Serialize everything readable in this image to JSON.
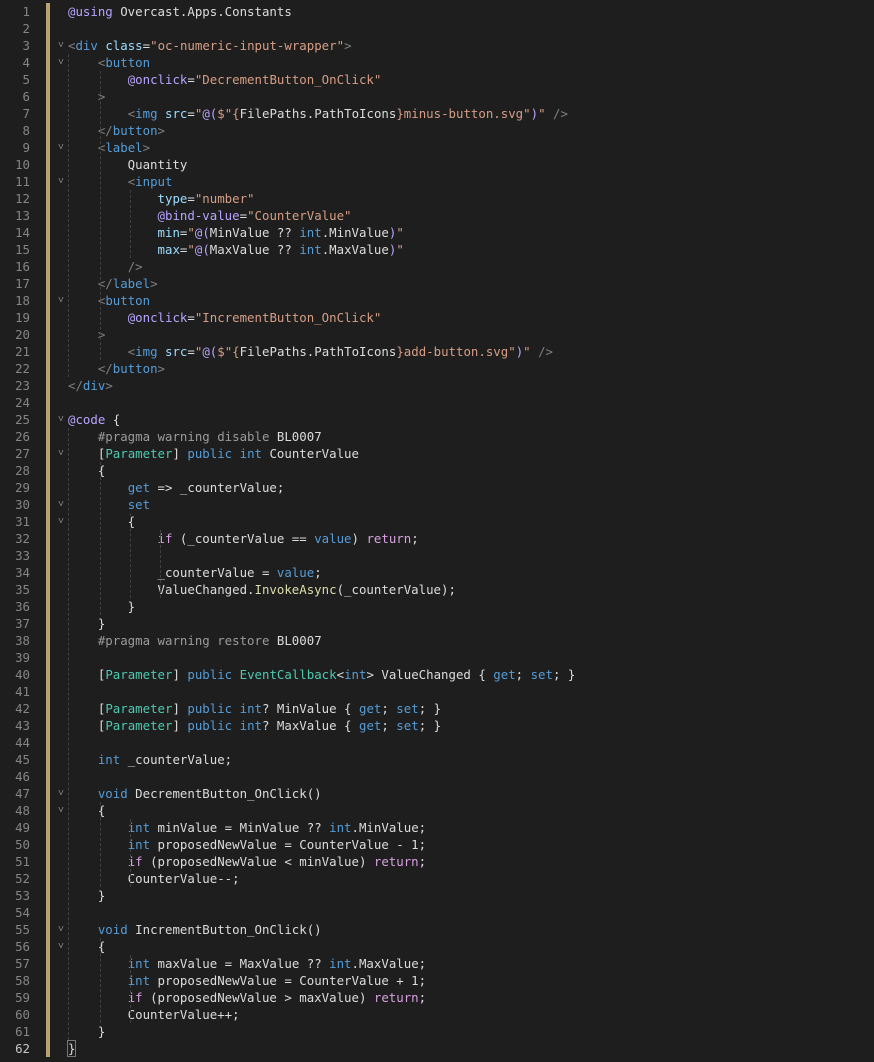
{
  "editor": {
    "current_line": 62,
    "lines": [
      [
        [
          "@using",
          "k-razor"
        ],
        [
          " Overcast.Apps.Constants",
          "k-plain"
        ]
      ],
      [],
      [
        [
          "<",
          "k-punc"
        ],
        [
          "div",
          "k-tag"
        ],
        [
          " ",
          "k-plain"
        ],
        [
          "class",
          "k-attr"
        ],
        [
          "=",
          "k-plain"
        ],
        [
          "\"oc-numeric-input-wrapper\"",
          "k-str"
        ],
        [
          ">",
          "k-punc"
        ]
      ],
      [
        [
          "    ",
          "k-plain"
        ],
        [
          "<",
          "k-punc"
        ],
        [
          "button",
          "k-tag"
        ]
      ],
      [
        [
          "        ",
          "k-plain"
        ],
        [
          "@onclick",
          "k-razor"
        ],
        [
          "=",
          "k-plain"
        ],
        [
          "\"DecrementButton_OnClick\"",
          "k-str"
        ]
      ],
      [
        [
          "    ",
          "k-plain"
        ],
        [
          ">",
          "k-punc"
        ]
      ],
      [
        [
          "        ",
          "k-plain"
        ],
        [
          "<",
          "k-punc"
        ],
        [
          "img",
          "k-tag"
        ],
        [
          " ",
          "k-plain"
        ],
        [
          "src",
          "k-attr"
        ],
        [
          "=",
          "k-plain"
        ],
        [
          "\"",
          "k-str"
        ],
        [
          "@(",
          "k-razor"
        ],
        [
          "$\"{",
          "k-str"
        ],
        [
          "FilePaths",
          "k-plain"
        ],
        [
          ".",
          "k-plain"
        ],
        [
          "PathToIcons",
          "k-plain"
        ],
        [
          "}minus-button.svg\"",
          "k-str"
        ],
        [
          ")",
          "k-razor"
        ],
        [
          "\"",
          "k-str"
        ],
        [
          " />",
          "k-punc"
        ]
      ],
      [
        [
          "    ",
          "k-plain"
        ],
        [
          "</",
          "k-punc"
        ],
        [
          "button",
          "k-tag"
        ],
        [
          ">",
          "k-punc"
        ]
      ],
      [
        [
          "    ",
          "k-plain"
        ],
        [
          "<",
          "k-punc"
        ],
        [
          "label",
          "k-tag"
        ],
        [
          ">",
          "k-punc"
        ]
      ],
      [
        [
          "        Quantity",
          "k-text"
        ]
      ],
      [
        [
          "        ",
          "k-plain"
        ],
        [
          "<",
          "k-punc"
        ],
        [
          "input",
          "k-tag"
        ]
      ],
      [
        [
          "            ",
          "k-plain"
        ],
        [
          "type",
          "k-attr"
        ],
        [
          "=",
          "k-plain"
        ],
        [
          "\"number\"",
          "k-str"
        ]
      ],
      [
        [
          "            ",
          "k-plain"
        ],
        [
          "@bind-value",
          "k-razor"
        ],
        [
          "=",
          "k-plain"
        ],
        [
          "\"CounterValue\"",
          "k-str"
        ]
      ],
      [
        [
          "            ",
          "k-plain"
        ],
        [
          "min",
          "k-attr"
        ],
        [
          "=",
          "k-plain"
        ],
        [
          "\"",
          "k-str"
        ],
        [
          "@(",
          "k-razor"
        ],
        [
          "MinValue ?? ",
          "k-plain"
        ],
        [
          "int",
          "k-kw"
        ],
        [
          ".MinValue",
          "k-plain"
        ],
        [
          ")",
          "k-razor"
        ],
        [
          "\"",
          "k-str"
        ]
      ],
      [
        [
          "            ",
          "k-plain"
        ],
        [
          "max",
          "k-attr"
        ],
        [
          "=",
          "k-plain"
        ],
        [
          "\"",
          "k-str"
        ],
        [
          "@(",
          "k-razor"
        ],
        [
          "MaxValue ?? ",
          "k-plain"
        ],
        [
          "int",
          "k-kw"
        ],
        [
          ".MaxValue",
          "k-plain"
        ],
        [
          ")",
          "k-razor"
        ],
        [
          "\"",
          "k-str"
        ]
      ],
      [
        [
          "        ",
          "k-plain"
        ],
        [
          "/>",
          "k-punc"
        ]
      ],
      [
        [
          "    ",
          "k-plain"
        ],
        [
          "</",
          "k-punc"
        ],
        [
          "label",
          "k-tag"
        ],
        [
          ">",
          "k-punc"
        ]
      ],
      [
        [
          "    ",
          "k-plain"
        ],
        [
          "<",
          "k-punc"
        ],
        [
          "button",
          "k-tag"
        ]
      ],
      [
        [
          "        ",
          "k-plain"
        ],
        [
          "@onclick",
          "k-razor"
        ],
        [
          "=",
          "k-plain"
        ],
        [
          "\"IncrementButton_OnClick\"",
          "k-str"
        ]
      ],
      [
        [
          "    ",
          "k-plain"
        ],
        [
          ">",
          "k-punc"
        ]
      ],
      [
        [
          "        ",
          "k-plain"
        ],
        [
          "<",
          "k-punc"
        ],
        [
          "img",
          "k-tag"
        ],
        [
          " ",
          "k-plain"
        ],
        [
          "src",
          "k-attr"
        ],
        [
          "=",
          "k-plain"
        ],
        [
          "\"",
          "k-str"
        ],
        [
          "@(",
          "k-razor"
        ],
        [
          "$\"{",
          "k-str"
        ],
        [
          "FilePaths",
          "k-plain"
        ],
        [
          ".",
          "k-plain"
        ],
        [
          "PathToIcons",
          "k-plain"
        ],
        [
          "}add-button.svg\"",
          "k-str"
        ],
        [
          ")",
          "k-razor"
        ],
        [
          "\"",
          "k-str"
        ],
        [
          " />",
          "k-punc"
        ]
      ],
      [
        [
          "    ",
          "k-plain"
        ],
        [
          "</",
          "k-punc"
        ],
        [
          "button",
          "k-tag"
        ],
        [
          ">",
          "k-punc"
        ]
      ],
      [
        [
          "</",
          "k-punc"
        ],
        [
          "div",
          "k-tag"
        ],
        [
          ">",
          "k-punc"
        ]
      ],
      [],
      [
        [
          "@code",
          "k-razor"
        ],
        [
          " {",
          "k-plain"
        ]
      ],
      [
        [
          "    ",
          "k-plain"
        ],
        [
          "#pragma warning disable ",
          "k-pre"
        ],
        [
          "BL0007",
          "k-plain"
        ]
      ],
      [
        [
          "    ",
          "k-plain"
        ],
        [
          "[",
          "k-plain"
        ],
        [
          "Parameter",
          "k-type"
        ],
        [
          "] ",
          "k-plain"
        ],
        [
          "public",
          "k-kw"
        ],
        [
          " ",
          "k-plain"
        ],
        [
          "int",
          "k-kw"
        ],
        [
          " CounterValue",
          "k-plain"
        ]
      ],
      [
        [
          "    {",
          "k-plain"
        ]
      ],
      [
        [
          "        ",
          "k-plain"
        ],
        [
          "get",
          "k-kw"
        ],
        [
          " => _counterValue;",
          "k-plain"
        ]
      ],
      [
        [
          "        ",
          "k-plain"
        ],
        [
          "set",
          "k-kw"
        ]
      ],
      [
        [
          "        {",
          "k-plain"
        ]
      ],
      [
        [
          "            ",
          "k-plain"
        ],
        [
          "if",
          "k-ctl"
        ],
        [
          " (_counterValue == ",
          "k-plain"
        ],
        [
          "value",
          "k-kw"
        ],
        [
          ") ",
          "k-plain"
        ],
        [
          "return",
          "k-ctl"
        ],
        [
          ";",
          "k-plain"
        ]
      ],
      [],
      [
        [
          "            _counterValue = ",
          "k-plain"
        ],
        [
          "value",
          "k-kw"
        ],
        [
          ";",
          "k-plain"
        ]
      ],
      [
        [
          "            ValueChanged.",
          "k-plain"
        ],
        [
          "InvokeAsync",
          "k-method"
        ],
        [
          "(_counterValue);",
          "k-plain"
        ]
      ],
      [
        [
          "        }",
          "k-plain"
        ]
      ],
      [
        [
          "    }",
          "k-plain"
        ]
      ],
      [
        [
          "    ",
          "k-plain"
        ],
        [
          "#pragma warning restore ",
          "k-pre"
        ],
        [
          "BL0007",
          "k-plain"
        ]
      ],
      [],
      [
        [
          "    ",
          "k-plain"
        ],
        [
          "[",
          "k-plain"
        ],
        [
          "Parameter",
          "k-type"
        ],
        [
          "] ",
          "k-plain"
        ],
        [
          "public",
          "k-kw"
        ],
        [
          " ",
          "k-plain"
        ],
        [
          "EventCallback",
          "k-type"
        ],
        [
          "<",
          "k-plain"
        ],
        [
          "int",
          "k-kw"
        ],
        [
          "> ValueChanged { ",
          "k-plain"
        ],
        [
          "get",
          "k-kw"
        ],
        [
          "; ",
          "k-plain"
        ],
        [
          "set",
          "k-kw"
        ],
        [
          "; }",
          "k-plain"
        ]
      ],
      [],
      [
        [
          "    ",
          "k-plain"
        ],
        [
          "[",
          "k-plain"
        ],
        [
          "Parameter",
          "k-type"
        ],
        [
          "] ",
          "k-plain"
        ],
        [
          "public",
          "k-kw"
        ],
        [
          " ",
          "k-plain"
        ],
        [
          "int",
          "k-kw"
        ],
        [
          "? MinValue { ",
          "k-plain"
        ],
        [
          "get",
          "k-kw"
        ],
        [
          "; ",
          "k-plain"
        ],
        [
          "set",
          "k-kw"
        ],
        [
          "; }",
          "k-plain"
        ]
      ],
      [
        [
          "    ",
          "k-plain"
        ],
        [
          "[",
          "k-plain"
        ],
        [
          "Parameter",
          "k-type"
        ],
        [
          "] ",
          "k-plain"
        ],
        [
          "public",
          "k-kw"
        ],
        [
          " ",
          "k-plain"
        ],
        [
          "int",
          "k-kw"
        ],
        [
          "? MaxValue { ",
          "k-plain"
        ],
        [
          "get",
          "k-kw"
        ],
        [
          "; ",
          "k-plain"
        ],
        [
          "set",
          "k-kw"
        ],
        [
          "; }",
          "k-plain"
        ]
      ],
      [],
      [
        [
          "    ",
          "k-plain"
        ],
        [
          "int",
          "k-kw"
        ],
        [
          " _counterValue;",
          "k-plain"
        ]
      ],
      [],
      [
        [
          "    ",
          "k-plain"
        ],
        [
          "void",
          "k-kw"
        ],
        [
          " DecrementButton_OnClick()",
          "k-plain"
        ]
      ],
      [
        [
          "    {",
          "k-plain"
        ]
      ],
      [
        [
          "        ",
          "k-plain"
        ],
        [
          "int",
          "k-kw"
        ],
        [
          " minValue = MinValue ?? ",
          "k-plain"
        ],
        [
          "int",
          "k-kw"
        ],
        [
          ".MinValue;",
          "k-plain"
        ]
      ],
      [
        [
          "        ",
          "k-plain"
        ],
        [
          "int",
          "k-kw"
        ],
        [
          " proposedNewValue = CounterValue - 1;",
          "k-plain"
        ]
      ],
      [
        [
          "        ",
          "k-plain"
        ],
        [
          "if",
          "k-ctl"
        ],
        [
          " (proposedNewValue < minValue) ",
          "k-plain"
        ],
        [
          "return",
          "k-ctl"
        ],
        [
          ";",
          "k-plain"
        ]
      ],
      [
        [
          "        CounterValue--;",
          "k-plain"
        ]
      ],
      [
        [
          "    }",
          "k-plain"
        ]
      ],
      [],
      [
        [
          "    ",
          "k-plain"
        ],
        [
          "void",
          "k-kw"
        ],
        [
          " IncrementButton_OnClick()",
          "k-plain"
        ]
      ],
      [
        [
          "    {",
          "k-plain"
        ]
      ],
      [
        [
          "        ",
          "k-plain"
        ],
        [
          "int",
          "k-kw"
        ],
        [
          " maxValue = MaxValue ?? ",
          "k-plain"
        ],
        [
          "int",
          "k-kw"
        ],
        [
          ".MaxValue;",
          "k-plain"
        ]
      ],
      [
        [
          "        ",
          "k-plain"
        ],
        [
          "int",
          "k-kw"
        ],
        [
          " proposedNewValue = CounterValue + 1;",
          "k-plain"
        ]
      ],
      [
        [
          "        ",
          "k-plain"
        ],
        [
          "if",
          "k-ctl"
        ],
        [
          " (proposedNewValue > maxValue) ",
          "k-plain"
        ],
        [
          "return",
          "k-ctl"
        ],
        [
          ";",
          "k-plain"
        ]
      ],
      [
        [
          "        CounterValue++;",
          "k-plain"
        ]
      ],
      [
        [
          "    }",
          "k-plain"
        ]
      ],
      [
        [
          "}",
          "k-plain"
        ]
      ]
    ]
  }
}
